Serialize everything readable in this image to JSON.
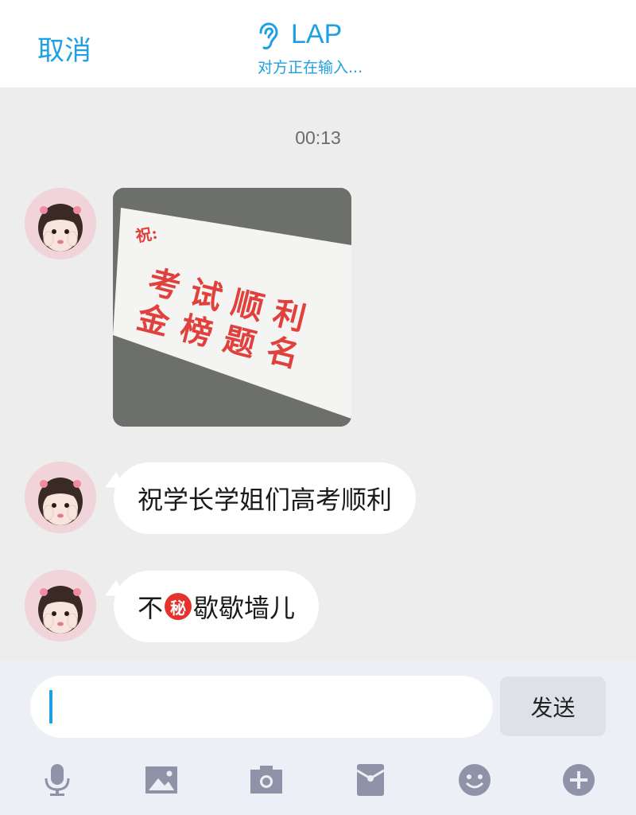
{
  "header": {
    "cancel_label": "取消",
    "contact_name": "LAP",
    "status": "对方正在输入..."
  },
  "chat": {
    "timestamp": "00:13",
    "messages": [
      {
        "type": "image",
        "image_desc": "envelope with red calligraphy",
        "image_text": [
          "祝:",
          "考试顺利",
          "金榜题名"
        ]
      },
      {
        "type": "text",
        "text": "祝学长学姐们高考顺利"
      },
      {
        "type": "text",
        "text_before": "不",
        "emoji": "秘",
        "text_after": "歇歇墙儿"
      }
    ]
  },
  "composer": {
    "input_value": "",
    "send_label": "发送",
    "toolbar_icons": [
      "microphone-icon",
      "image-icon",
      "camera-icon",
      "red-packet-icon",
      "emoji-icon",
      "plus-icon"
    ]
  },
  "colors": {
    "accent": "#1fa0e0",
    "background": "#ededed",
    "composer_background": "#eceff6",
    "icon_gray": "#8e93a8"
  }
}
